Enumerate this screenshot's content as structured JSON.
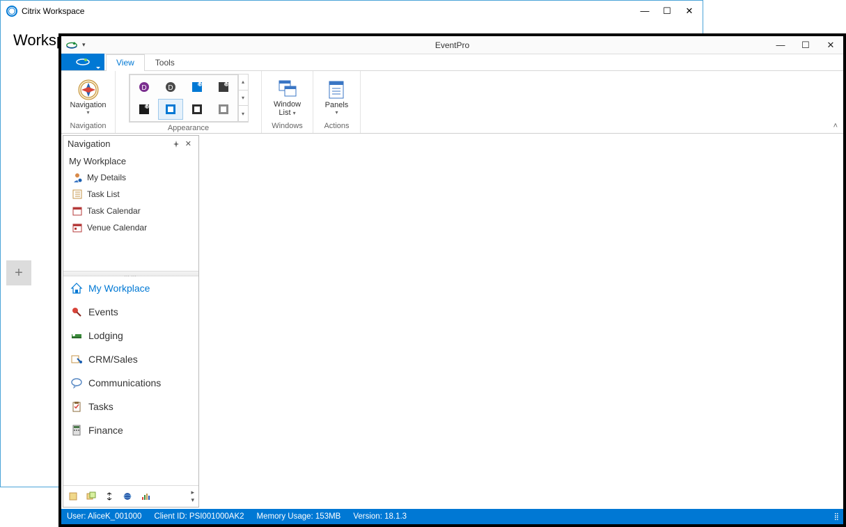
{
  "citrix": {
    "title": "Citrix Workspace",
    "body_heading": "Worksp",
    "plus": "+"
  },
  "eventpro": {
    "app_title": "EventPro",
    "tabs": {
      "view": "View",
      "tools": "Tools"
    },
    "ribbon": {
      "navigation_btn": "Navigation",
      "group_navigation": "Navigation",
      "group_appearance": "Appearance",
      "windowlist_btn_l1": "Window",
      "windowlist_btn_l2": "List",
      "group_windows": "Windows",
      "panels_btn": "Panels",
      "group_actions": "Actions"
    },
    "nav": {
      "panel_title": "Navigation",
      "section_title": "My Workplace",
      "items": [
        {
          "label": "My Details"
        },
        {
          "label": "Task List"
        },
        {
          "label": "Task Calendar"
        },
        {
          "label": "Venue Calendar"
        }
      ],
      "modules": [
        {
          "label": "My Workplace"
        },
        {
          "label": "Events"
        },
        {
          "label": "Lodging"
        },
        {
          "label": "CRM/Sales"
        },
        {
          "label": "Communications"
        },
        {
          "label": "Tasks"
        },
        {
          "label": "Finance"
        }
      ]
    },
    "status": {
      "user": "User: AliceK_001000",
      "client": "Client ID: PSI001000AK2",
      "memory": "Memory Usage: 153MB",
      "version": "Version: 18.1.3"
    }
  }
}
